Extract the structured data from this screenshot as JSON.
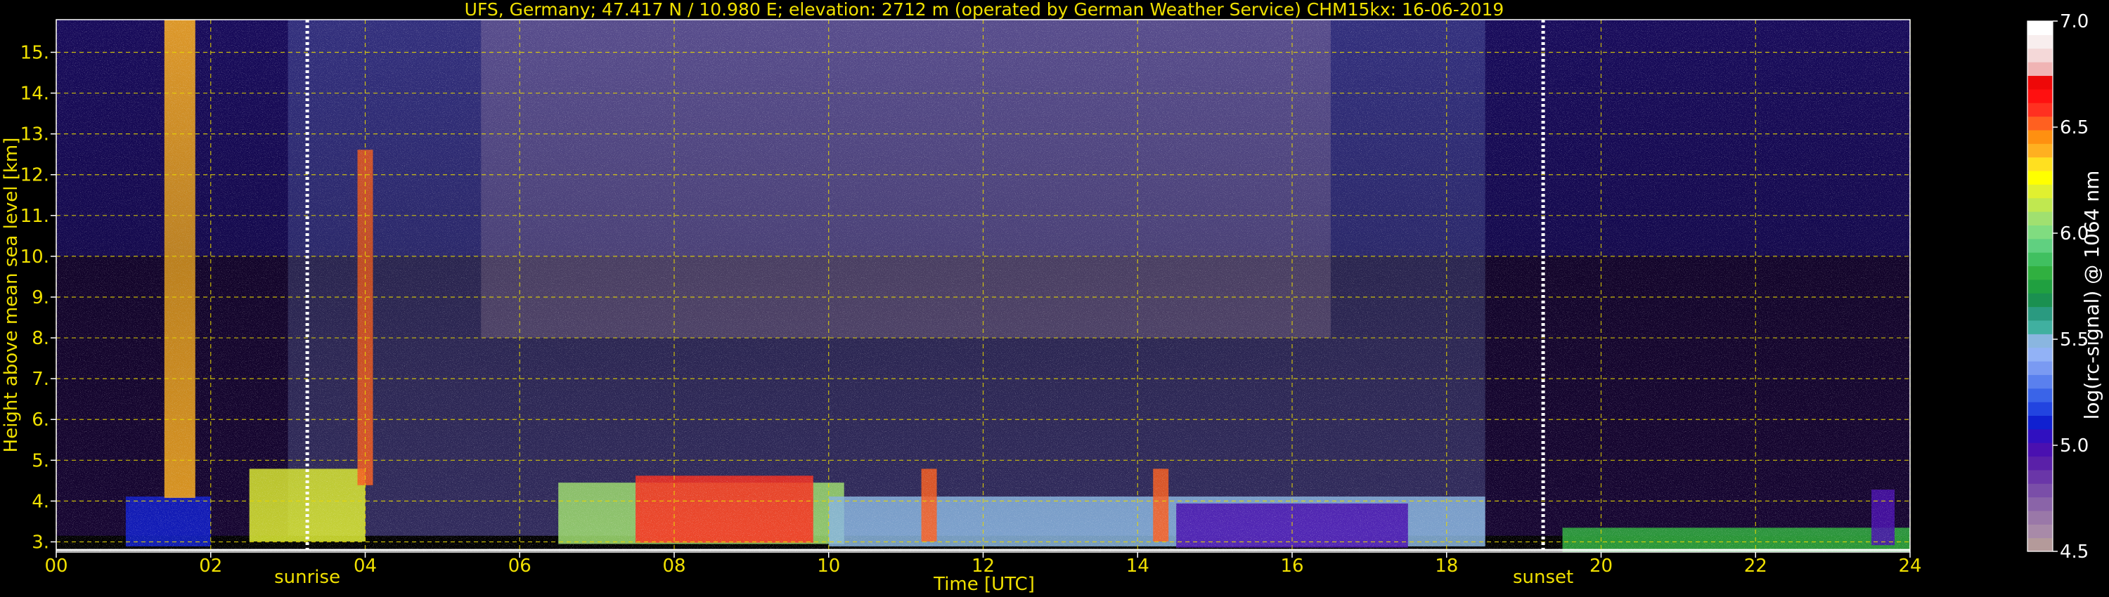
{
  "chart_data": {
    "type": "heatmap",
    "title": "UFS, Germany; 47.417 N / 10.980 E; elevation: 2712 m  (operated by German Weather Service)    CHM15kx: 16-06-2019",
    "xlabel": "Time [UTC]",
    "ylabel": "Height above mean sea level [km]",
    "xlim": [
      0,
      24
    ],
    "ylim": [
      2.75,
      15.8
    ],
    "x_ticks": [
      0,
      2,
      4,
      6,
      8,
      10,
      12,
      14,
      16,
      18,
      20,
      22,
      24
    ],
    "x_tick_labels": [
      "00",
      "02",
      "04",
      "06",
      "08",
      "10",
      "12",
      "14",
      "16",
      "18",
      "20",
      "22",
      "24"
    ],
    "y_ticks": [
      3,
      4,
      5,
      6,
      7,
      8,
      9,
      10,
      11,
      12,
      13,
      14,
      15
    ],
    "y_tick_labels": [
      "3.",
      "4.",
      "5.",
      "6.",
      "7.",
      "8.",
      "9.",
      "10.",
      "11.",
      "12.",
      "13.",
      "14.",
      "15."
    ],
    "grid": true,
    "markers": [
      {
        "label": "sunrise",
        "x": 3.25
      },
      {
        "label": "sunset",
        "x": 19.25
      }
    ],
    "colorbar": {
      "label": "log(rc-signal) @ 1064 nm",
      "range": [
        4.5,
        7.0
      ],
      "ticks": [
        4.5,
        5.0,
        5.5,
        6.0,
        6.5,
        7.0
      ],
      "tick_labels": [
        "4.5",
        "5.0",
        "5.5",
        "6.0",
        "6.5",
        "7.0"
      ],
      "colors": [
        "#b49a9a",
        "#a88aa8",
        "#9a78a8",
        "#8a64a8",
        "#7a4ea8",
        "#6a36a8",
        "#5a20a8",
        "#4a10b0",
        "#3010c0",
        "#1020d0",
        "#2244e0",
        "#3a64e8",
        "#5a80ee",
        "#7a9af2",
        "#92b2f6",
        "#8ab6e0",
        "#40b0a0",
        "#2a9a80",
        "#1a9050",
        "#20a040",
        "#30b040",
        "#40c060",
        "#60d080",
        "#80dc80",
        "#a0e070",
        "#c0e850",
        "#e0f030",
        "#ffff00",
        "#ffe020",
        "#ffb020",
        "#ff9010",
        "#ff6020",
        "#ff3020",
        "#ff1010",
        "#ee0808",
        "#f0b4b4",
        "#f4d8d8",
        "#f8eeee",
        "#ffffff"
      ]
    },
    "series": [
      {
        "x_range": [
          0,
          24
        ],
        "height_km": 15.0,
        "log_signal": 5.1
      },
      {
        "x_range": [
          0,
          24
        ],
        "height_km": 7.0,
        "log_signal": 5.0
      },
      {
        "x_range": [
          5.5,
          16.5
        ],
        "height_km": 13.0,
        "log_signal": 6.8
      },
      {
        "x_range": [
          3.0,
          18.5
        ],
        "height_km": 8.0,
        "log_signal": 5.4
      },
      {
        "x_range": [
          0.9,
          2.0
        ],
        "height_km": 3.5,
        "log_signal": 5.1
      },
      {
        "x_range": [
          2.5,
          4.0
        ],
        "height_km": 3.9,
        "log_signal": 6.2
      },
      {
        "x_range": [
          6.5,
          10.2
        ],
        "height_km": 3.7,
        "log_signal": 6.1
      },
      {
        "x_range": [
          7.5,
          9.8
        ],
        "height_km": 3.8,
        "log_signal": 6.6
      },
      {
        "x_range": [
          10.0,
          18.5
        ],
        "height_km": 3.5,
        "log_signal": 5.5
      },
      {
        "x_range": [
          11.2,
          11.4
        ],
        "height_km": 3.9,
        "log_signal": 6.5
      },
      {
        "x_range": [
          14.2,
          14.4
        ],
        "height_km": 3.9,
        "log_signal": 6.5
      },
      {
        "x_range": [
          14.5,
          17.5
        ],
        "height_km": 3.4,
        "log_signal": 5.0
      },
      {
        "x_range": [
          1.4,
          1.8
        ],
        "height_km": 11.0,
        "log_signal": 6.4
      },
      {
        "x_range": [
          3.9,
          4.1
        ],
        "height_km": 8.5,
        "log_signal": 6.5
      },
      {
        "x_range": [
          19.5,
          24
        ],
        "height_km": 3.05,
        "log_signal": 5.8
      },
      {
        "x_range": [
          23.5,
          23.8
        ],
        "height_km": 3.6,
        "log_signal": 5.0
      }
    ]
  }
}
